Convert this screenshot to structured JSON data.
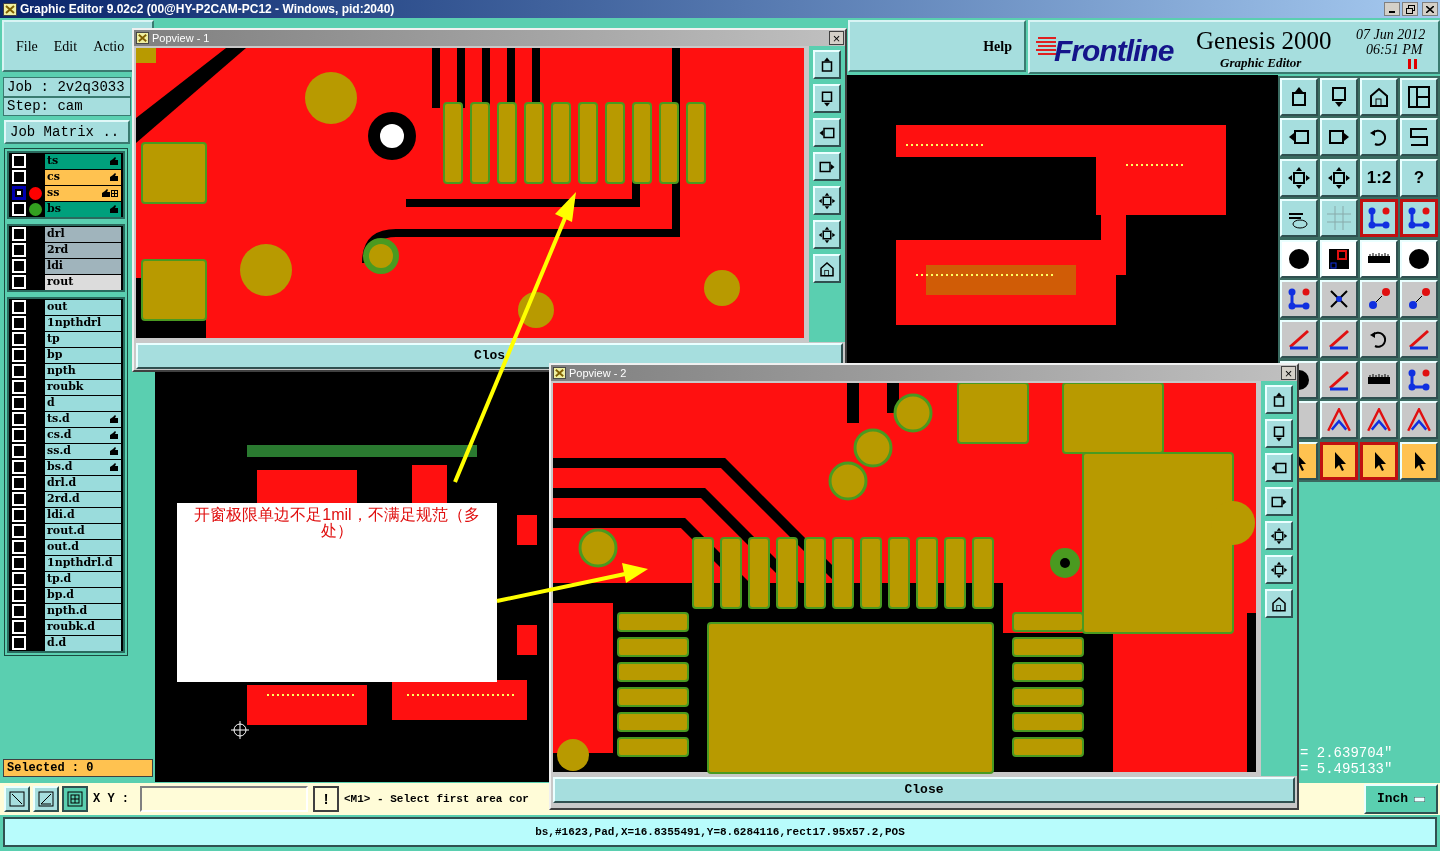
{
  "window": {
    "title": "Graphic Editor 9.02c2 (00@HY-P2CAM-PC12 - Windows, pid:2040)"
  },
  "menu": [
    {
      "label": "File"
    },
    {
      "label": "Edit"
    },
    {
      "label": "Actio"
    }
  ],
  "help_menu": "Help",
  "brand": {
    "logo": "Frontline",
    "product": "Genesis 2000",
    "subtitle": "Graphic Editor",
    "date": "07 Jun 2012",
    "time": "06:51 PM"
  },
  "job": {
    "job": "Job : 2v2q3033",
    "step": "Step: cam",
    "matrix_button": "Job Matrix .."
  },
  "layer_groups": [
    {
      "layers": [
        {
          "name": "ts",
          "kind": "mask",
          "hand": true,
          "grid_mark": false,
          "selected": false
        },
        {
          "name": "cs",
          "kind": "silk",
          "hand": true,
          "grid_mark": false,
          "selected": false
        },
        {
          "name": "ss",
          "kind": "silk",
          "hand": true,
          "grid_mark": true,
          "selected": true,
          "color": "#ff0000"
        },
        {
          "name": "bs",
          "kind": "mask",
          "hand": true,
          "grid_mark": false,
          "selected": false,
          "color": "#33a020"
        }
      ]
    },
    {
      "layers": [
        {
          "name": "drl",
          "kind": "drill",
          "hand": false,
          "grid_mark": false,
          "selected": false
        },
        {
          "name": "2rd",
          "kind": "drill",
          "hand": false,
          "grid_mark": false,
          "selected": false
        },
        {
          "name": "ldi",
          "kind": "drill",
          "hand": false,
          "grid_mark": false,
          "selected": false
        },
        {
          "name": "rout",
          "kind": "rout",
          "hand": false,
          "grid_mark": false,
          "selected": false
        }
      ]
    },
    {
      "layers": [
        {
          "name": "out",
          "kind": "misc",
          "hand": false,
          "grid_mark": false,
          "selected": false
        },
        {
          "name": "1npthdrl",
          "kind": "misc",
          "hand": false,
          "grid_mark": false,
          "selected": false
        },
        {
          "name": "tp",
          "kind": "misc",
          "hand": false,
          "grid_mark": false,
          "selected": false
        },
        {
          "name": "bp",
          "kind": "misc",
          "hand": false,
          "grid_mark": false,
          "selected": false
        },
        {
          "name": "npth",
          "kind": "misc",
          "hand": false,
          "grid_mark": false,
          "selected": false
        },
        {
          "name": "roubk",
          "kind": "misc",
          "hand": false,
          "grid_mark": false,
          "selected": false
        },
        {
          "name": "d",
          "kind": "misc",
          "hand": false,
          "grid_mark": false,
          "selected": false
        },
        {
          "name": "ts.d",
          "kind": "misc",
          "hand": true,
          "grid_mark": false,
          "selected": false
        },
        {
          "name": "cs.d",
          "kind": "misc",
          "hand": true,
          "grid_mark": false,
          "selected": false
        },
        {
          "name": "ss.d",
          "kind": "misc",
          "hand": true,
          "grid_mark": false,
          "selected": false
        },
        {
          "name": "bs.d",
          "kind": "misc",
          "hand": true,
          "grid_mark": false,
          "selected": false
        },
        {
          "name": "drl.d",
          "kind": "misc",
          "hand": false,
          "grid_mark": false,
          "selected": false
        },
        {
          "name": "2rd.d",
          "kind": "misc",
          "hand": false,
          "grid_mark": false,
          "selected": false
        },
        {
          "name": "ldi.d",
          "kind": "misc",
          "hand": false,
          "grid_mark": false,
          "selected": false
        },
        {
          "name": "rout.d",
          "kind": "misc",
          "hand": false,
          "grid_mark": false,
          "selected": false
        },
        {
          "name": "out.d",
          "kind": "misc",
          "hand": false,
          "grid_mark": false,
          "selected": false
        },
        {
          "name": "1npthdrl.d",
          "kind": "misc",
          "hand": false,
          "grid_mark": false,
          "selected": false
        },
        {
          "name": "tp.d",
          "kind": "misc",
          "hand": false,
          "grid_mark": false,
          "selected": false
        },
        {
          "name": "bp.d",
          "kind": "misc",
          "hand": false,
          "grid_mark": false,
          "selected": false
        },
        {
          "name": "npth.d",
          "kind": "misc",
          "hand": false,
          "grid_mark": false,
          "selected": false
        },
        {
          "name": "roubk.d",
          "kind": "misc",
          "hand": false,
          "grid_mark": false,
          "selected": false
        },
        {
          "name": "d.d",
          "kind": "misc",
          "hand": false,
          "grid_mark": false,
          "selected": false
        }
      ]
    }
  ],
  "selected_count": "Selected : 0",
  "tools": [
    {
      "kind": "teal",
      "active": false
    },
    {
      "kind": "teal",
      "active": false
    },
    {
      "kind": "teal",
      "active": false
    },
    {
      "kind": "teal",
      "active": false
    },
    {
      "kind": "teal",
      "active": false
    },
    {
      "kind": "teal",
      "active": false
    },
    {
      "kind": "teal",
      "active": false
    },
    {
      "kind": "teal",
      "active": false
    },
    {
      "kind": "teal",
      "active": false
    },
    {
      "kind": "teal",
      "active": false
    },
    {
      "kind": "teal",
      "active": false,
      "label": "1:2"
    },
    {
      "kind": "teal",
      "active": false,
      "label": "?"
    },
    {
      "kind": "teal",
      "active": false
    },
    {
      "kind": "teal",
      "active": false
    },
    {
      "kind": "teal",
      "active": true
    },
    {
      "kind": "teal",
      "active": true
    },
    {
      "kind": "white",
      "active": false
    },
    {
      "kind": "white",
      "active": false
    },
    {
      "kind": "white",
      "active": false
    },
    {
      "kind": "white",
      "active": false
    },
    {
      "kind": "grey",
      "active": false
    },
    {
      "kind": "grey",
      "active": false
    },
    {
      "kind": "grey",
      "active": false
    },
    {
      "kind": "grey",
      "active": false
    },
    {
      "kind": "grey",
      "active": false
    },
    {
      "kind": "grey",
      "active": false
    },
    {
      "kind": "grey",
      "active": false
    },
    {
      "kind": "grey",
      "active": false
    },
    {
      "kind": "grey",
      "active": false
    },
    {
      "kind": "grey",
      "active": false
    },
    {
      "kind": "grey",
      "active": false
    },
    {
      "kind": "grey",
      "active": false
    },
    {
      "kind": "grey",
      "active": false
    },
    {
      "kind": "grey",
      "active": false
    },
    {
      "kind": "grey",
      "active": false
    },
    {
      "kind": "grey",
      "active": false
    },
    {
      "kind": "orange",
      "active": false
    },
    {
      "kind": "orange",
      "active": true
    },
    {
      "kind": "orange",
      "active": true
    },
    {
      "kind": "orange",
      "active": false
    }
  ],
  "coordinates": [
    "= 2.639704\"",
    "= 5.495133\""
  ],
  "popviews": [
    {
      "title": "Popview - 1",
      "close_icon": "×",
      "close": "Clos"
    },
    {
      "title": "Popview - 2",
      "close_icon": "×",
      "close": "Close"
    }
  ],
  "annotation": "开窗极限单边不足1mil，不满足规范（多处）",
  "command_bar": {
    "xy_label": "X Y :",
    "alert": "!",
    "message": "<M1> - Select first area cor",
    "units": "Inch"
  },
  "status_bar": "bs,#1623,Pad,X=16.8355491,Y=8.6284116,rect17.95x57.2,POS"
}
